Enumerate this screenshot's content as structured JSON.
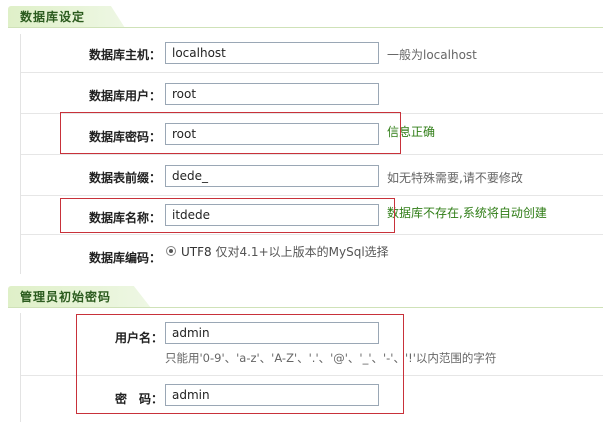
{
  "db_section": {
    "title": "数据库设定",
    "fields": [
      {
        "label": "数据库主机：",
        "value": "localhost",
        "hint": "一般为localhost",
        "hint_type": "normal"
      },
      {
        "label": "数据库用户：",
        "value": "root",
        "hint": "",
        "hint_type": "normal"
      },
      {
        "label": "数据库密码：",
        "value": "root",
        "hint": "信息正确",
        "hint_type": "ok"
      },
      {
        "label": "数据表前缀：",
        "value": "dede_",
        "hint": "如无特殊需要,请不要修改",
        "hint_type": "normal"
      },
      {
        "label": "数据库名称：",
        "value": "itdede",
        "hint": "数据库不存在,系统将自动创建",
        "hint_type": "ok"
      }
    ],
    "encoding": {
      "label": "数据库编码：",
      "option": "UTF8",
      "note": "仅对4.1+以上版本的MySql选择"
    }
  },
  "admin_section": {
    "title": "管理员初始密码",
    "username": {
      "label": "用户名：",
      "value": "admin",
      "hint": "只能用'0-9'、'a-z'、'A-Z'、'.'、'@'、'_'、'-'、'!'以内范围的字符"
    },
    "password": {
      "label": "密　码：",
      "value": "admin"
    }
  },
  "colors": {
    "header_text": "#2b5b1e",
    "ok_text": "#2f7d16",
    "highlight_border": "#c8313a"
  }
}
